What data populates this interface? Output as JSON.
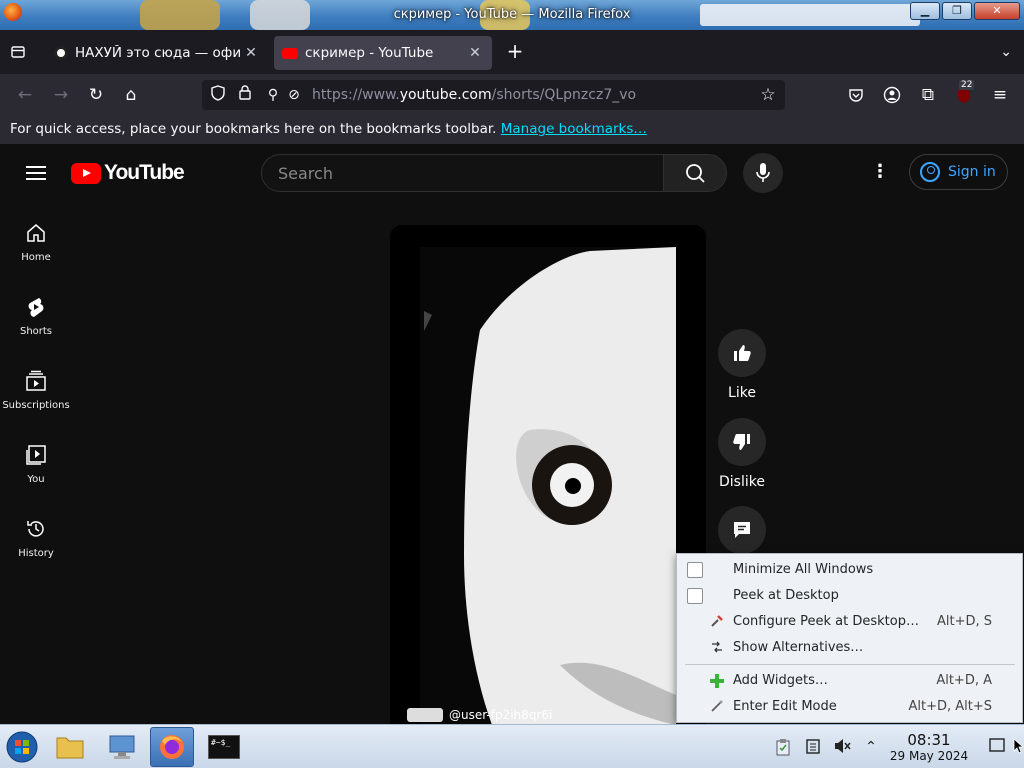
{
  "window": {
    "title": "скример - YouTube — Mozilla Firefox",
    "min": "▁",
    "max": "❐",
    "close": "✕"
  },
  "tabs": [
    {
      "title": "НАХУЙ это сюда — офи",
      "close": "✕"
    },
    {
      "title": "скример - YouTube",
      "close": "✕"
    }
  ],
  "new_tab": "+",
  "list_all_tabs": "⌄",
  "url": {
    "prefix": "https://www.",
    "host": "youtube.com",
    "path": "/shorts/QLpnzcz7_vo"
  },
  "extensions_badge": "22",
  "bookmarks_bar": {
    "text": "For quick access, place your bookmarks here on the bookmarks toolbar.",
    "link": "Manage bookmarks…"
  },
  "youtube": {
    "logo_text": "YouTube",
    "search_placeholder": "Search",
    "sign_in": "Sign in",
    "guide": [
      {
        "label": "Home",
        "icon": "home-icon"
      },
      {
        "label": "Shorts",
        "icon": "shorts-icon"
      },
      {
        "label": "Subscriptions",
        "icon": "subscriptions-icon"
      },
      {
        "label": "You",
        "icon": "you-icon"
      },
      {
        "label": "History",
        "icon": "history-icon"
      }
    ],
    "actions": {
      "like": "Like",
      "dislike": "Dislike"
    },
    "channel_handle": "@user-fp2ih8qr6i"
  },
  "context_menu": {
    "items": [
      {
        "label": "Minimize All Windows",
        "shortcut": "",
        "type": "checkbox",
        "checked": false
      },
      {
        "label": "Peek at Desktop",
        "shortcut": "",
        "type": "checkbox",
        "checked": false
      },
      {
        "label": "Configure Peek at Desktop…",
        "shortcut": "Alt+D, S",
        "type": "icon",
        "icon": "configure-icon"
      },
      {
        "label": "Show Alternatives…",
        "shortcut": "",
        "type": "icon",
        "icon": "alternatives-icon"
      },
      {
        "label": "Add Widgets…",
        "shortcut": "Alt+D, A",
        "type": "icon",
        "icon": "add-icon"
      },
      {
        "label": "Enter Edit Mode",
        "shortcut": "Alt+D, Alt+S",
        "type": "icon",
        "icon": "edit-icon"
      }
    ]
  },
  "taskbar": {
    "time": "08:31",
    "date": "29 May 2024",
    "terminal_label": "#~$_"
  },
  "colors": {
    "youtube_red": "#ff0000",
    "link": "#00ddff",
    "signin_blue": "#3ea6ff",
    "firefox_toolbar": "#2b2a33"
  }
}
